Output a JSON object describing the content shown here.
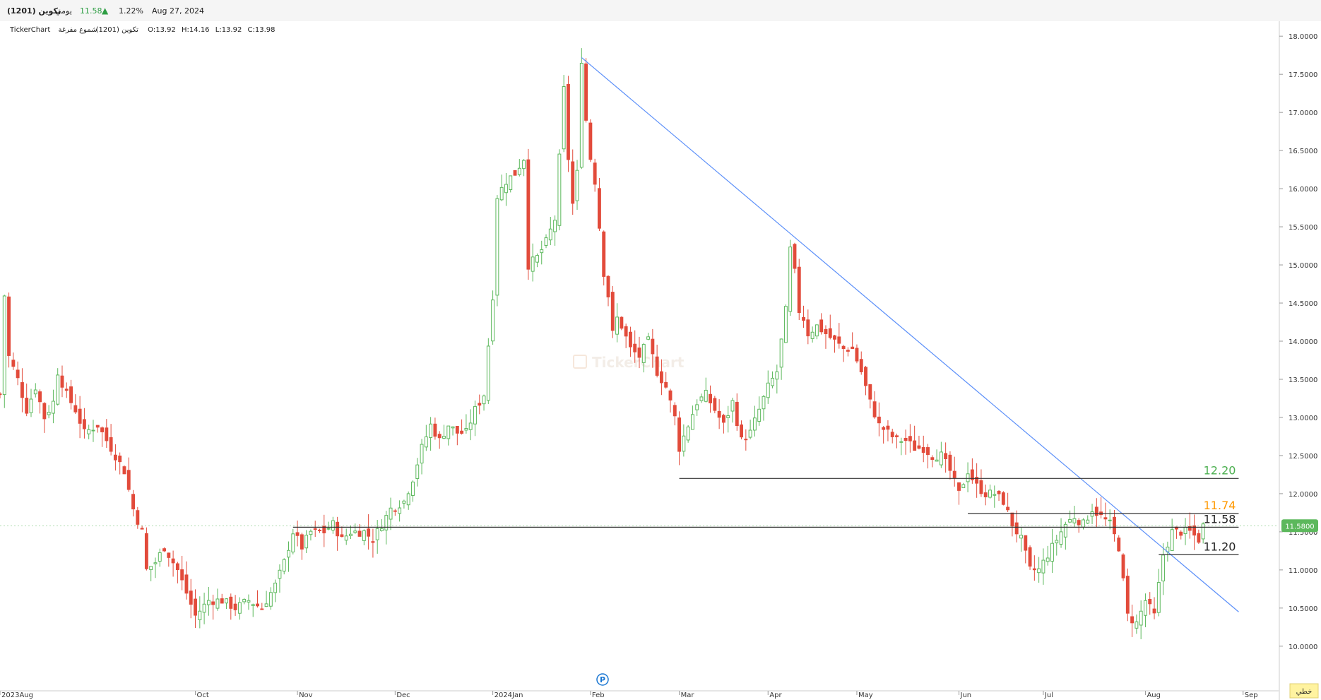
{
  "header": {
    "symbol": "تكوين (1201)",
    "timeframe": "يومي",
    "last_price": "11.58",
    "change_pct": "1.22%",
    "date": "Aug 27, 2024",
    "change_direction": "up"
  },
  "legend": {
    "source": "TickerChart",
    "symbol": "تكوين (1201)",
    "chart_style": "شموع مفرغة",
    "open": "O:13.92",
    "high": "H:14.16",
    "low": "L:13.92",
    "close": "C:13.98"
  },
  "watermark": "TickerChart",
  "footer": {
    "mode_button": "خطي",
    "event_marker": "P"
  },
  "colors": {
    "up": "#5cb85c",
    "down": "#e24b3b",
    "trendline": "#5b8ff9",
    "support_line": "#333333",
    "label_green": "#4caf50",
    "label_orange": "#ff9800",
    "price_badge": "#5cb85c",
    "event_marker": "#1976d2"
  },
  "chart_data": {
    "type": "candlestick",
    "x_axis": {
      "ticks": [
        {
          "label": "2023Aug",
          "x": 0
        },
        {
          "label": "Oct",
          "x": 44
        },
        {
          "label": "Nov",
          "x": 67
        },
        {
          "label": "Dec",
          "x": 89
        },
        {
          "label": "2024Jan",
          "x": 111
        },
        {
          "label": "Feb",
          "x": 133
        },
        {
          "label": "Mar",
          "x": 153
        },
        {
          "label": "Apr",
          "x": 173
        },
        {
          "label": "May",
          "x": 193
        },
        {
          "label": "Jun",
          "x": 216
        },
        {
          "label": "Jul",
          "x": 235
        },
        {
          "label": "Aug",
          "x": 258
        },
        {
          "label": "Sep",
          "x": 280
        }
      ],
      "xlim": [
        0,
        288
      ]
    },
    "y_axis": {
      "ylim": [
        9.6,
        18.15
      ],
      "ticks": [
        "10.0000",
        "10.5000",
        "11.0000",
        "11.5000",
        "12.0000",
        "12.5000",
        "13.0000",
        "13.5000",
        "14.0000",
        "14.5000",
        "15.0000",
        "15.5000",
        "16.0000",
        "16.5000",
        "17.0000",
        "17.5000",
        "18.0000"
      ],
      "current_price_badge": "11.5800",
      "current_price": 11.58
    },
    "lines": [
      {
        "name": "trendline",
        "kind": "diagonal",
        "x1": 131,
        "y1": 17.72,
        "x2": 279,
        "y2": 10.45
      },
      {
        "name": "level-12.20",
        "kind": "horizontal",
        "x1": 153,
        "x2": 279,
        "y": 12.2,
        "label": "12.20",
        "label_color": "green"
      },
      {
        "name": "level-11.74",
        "kind": "horizontal",
        "x1": 218,
        "x2": 279,
        "y": 11.74,
        "label": "11.74",
        "label_color": "orange"
      },
      {
        "name": "level-11.58",
        "kind": "horizontal",
        "x1": 66,
        "x2": 279,
        "y": 11.56,
        "label": "11.58",
        "label_color": "dark"
      },
      {
        "name": "level-11.20",
        "kind": "horizontal",
        "x1": 261,
        "x2": 279,
        "y": 11.2,
        "label": "11.20",
        "label_color": "dark"
      }
    ],
    "close_path": [
      [
        0,
        13.3
      ],
      [
        1,
        14.6
      ],
      [
        2,
        13.8
      ],
      [
        4,
        13.5
      ],
      [
        6,
        13.1
      ],
      [
        8,
        13.4
      ],
      [
        10,
        13.0
      ],
      [
        12,
        13.2
      ],
      [
        13,
        13.6
      ],
      [
        15,
        13.3
      ],
      [
        17,
        13.1
      ],
      [
        19,
        12.8
      ],
      [
        22,
        12.9
      ],
      [
        24,
        12.7
      ],
      [
        26,
        12.5
      ],
      [
        28,
        12.3
      ],
      [
        30,
        11.8
      ],
      [
        32,
        11.5
      ],
      [
        33,
        11.0
      ],
      [
        35,
        11.1
      ],
      [
        37,
        11.3
      ],
      [
        40,
        11.0
      ],
      [
        42,
        10.7
      ],
      [
        44,
        10.4
      ],
      [
        47,
        10.6
      ],
      [
        50,
        10.6
      ],
      [
        53,
        10.5
      ],
      [
        56,
        10.6
      ],
      [
        59,
        10.5
      ],
      [
        62,
        10.8
      ],
      [
        64,
        11.1
      ],
      [
        66,
        11.5
      ],
      [
        68,
        11.3
      ],
      [
        70,
        11.5
      ],
      [
        73,
        11.5
      ],
      [
        75,
        11.6
      ],
      [
        77,
        11.4
      ],
      [
        79,
        11.5
      ],
      [
        82,
        11.5
      ],
      [
        84,
        11.4
      ],
      [
        86,
        11.6
      ],
      [
        88,
        11.8
      ],
      [
        91,
        11.9
      ],
      [
        93,
        12.2
      ],
      [
        95,
        12.6
      ],
      [
        97,
        12.9
      ],
      [
        99,
        12.7
      ],
      [
        101,
        12.9
      ],
      [
        103,
        12.8
      ],
      [
        105,
        12.8
      ],
      [
        107,
        13.1
      ],
      [
        109,
        13.3
      ],
      [
        111,
        14.6
      ],
      [
        112,
        15.9
      ],
      [
        114,
        16.1
      ],
      [
        116,
        16.2
      ],
      [
        118,
        16.4
      ],
      [
        119,
        15.0
      ],
      [
        121,
        15.1
      ],
      [
        123,
        15.3
      ],
      [
        125,
        15.6
      ],
      [
        126,
        16.4
      ],
      [
        127,
        17.3
      ],
      [
        128,
        16.4
      ],
      [
        129,
        15.8
      ],
      [
        130,
        16.2
      ],
      [
        131,
        17.7
      ],
      [
        132,
        16.9
      ],
      [
        133,
        16.4
      ],
      [
        134,
        16.1
      ],
      [
        135,
        15.5
      ],
      [
        136,
        14.9
      ],
      [
        137,
        14.6
      ],
      [
        138,
        14.1
      ],
      [
        139,
        14.3
      ],
      [
        140,
        14.2
      ],
      [
        142,
        13.9
      ],
      [
        144,
        13.8
      ],
      [
        146,
        14.0
      ],
      [
        148,
        13.6
      ],
      [
        150,
        13.4
      ],
      [
        152,
        13.0
      ],
      [
        153,
        12.6
      ],
      [
        155,
        12.9
      ],
      [
        157,
        13.2
      ],
      [
        159,
        13.3
      ],
      [
        161,
        13.1
      ],
      [
        163,
        12.9
      ],
      [
        165,
        13.2
      ],
      [
        167,
        12.7
      ],
      [
        169,
        12.8
      ],
      [
        171,
        13.1
      ],
      [
        173,
        13.4
      ],
      [
        175,
        13.6
      ],
      [
        177,
        14.4
      ],
      [
        178,
        15.2
      ],
      [
        179,
        14.9
      ],
      [
        180,
        14.4
      ],
      [
        181,
        14.3
      ],
      [
        182,
        14.1
      ],
      [
        184,
        14.2
      ],
      [
        186,
        14.1
      ],
      [
        188,
        14.0
      ],
      [
        190,
        13.9
      ],
      [
        192,
        13.9
      ],
      [
        194,
        13.6
      ],
      [
        196,
        13.2
      ],
      [
        198,
        12.9
      ],
      [
        200,
        12.8
      ],
      [
        202,
        12.7
      ],
      [
        204,
        12.7
      ],
      [
        206,
        12.6
      ],
      [
        208,
        12.6
      ],
      [
        210,
        12.5
      ],
      [
        212,
        12.5
      ],
      [
        214,
        12.3
      ],
      [
        216,
        12.0
      ],
      [
        218,
        12.3
      ],
      [
        220,
        12.1
      ],
      [
        222,
        12.0
      ],
      [
        224,
        12.0
      ],
      [
        226,
        11.9
      ],
      [
        228,
        11.6
      ],
      [
        230,
        11.4
      ],
      [
        232,
        11.0
      ],
      [
        234,
        11.0
      ],
      [
        236,
        11.2
      ],
      [
        238,
        11.4
      ],
      [
        240,
        11.6
      ],
      [
        242,
        11.7
      ],
      [
        244,
        11.6
      ],
      [
        246,
        11.8
      ],
      [
        248,
        11.7
      ],
      [
        250,
        11.6
      ],
      [
        252,
        11.3
      ],
      [
        254,
        10.4
      ],
      [
        256,
        10.3
      ],
      [
        258,
        10.6
      ],
      [
        260,
        10.4
      ],
      [
        262,
        11.2
      ],
      [
        264,
        11.5
      ],
      [
        266,
        11.5
      ],
      [
        268,
        11.5
      ],
      [
        270,
        11.4
      ],
      [
        271,
        11.58
      ]
    ]
  }
}
